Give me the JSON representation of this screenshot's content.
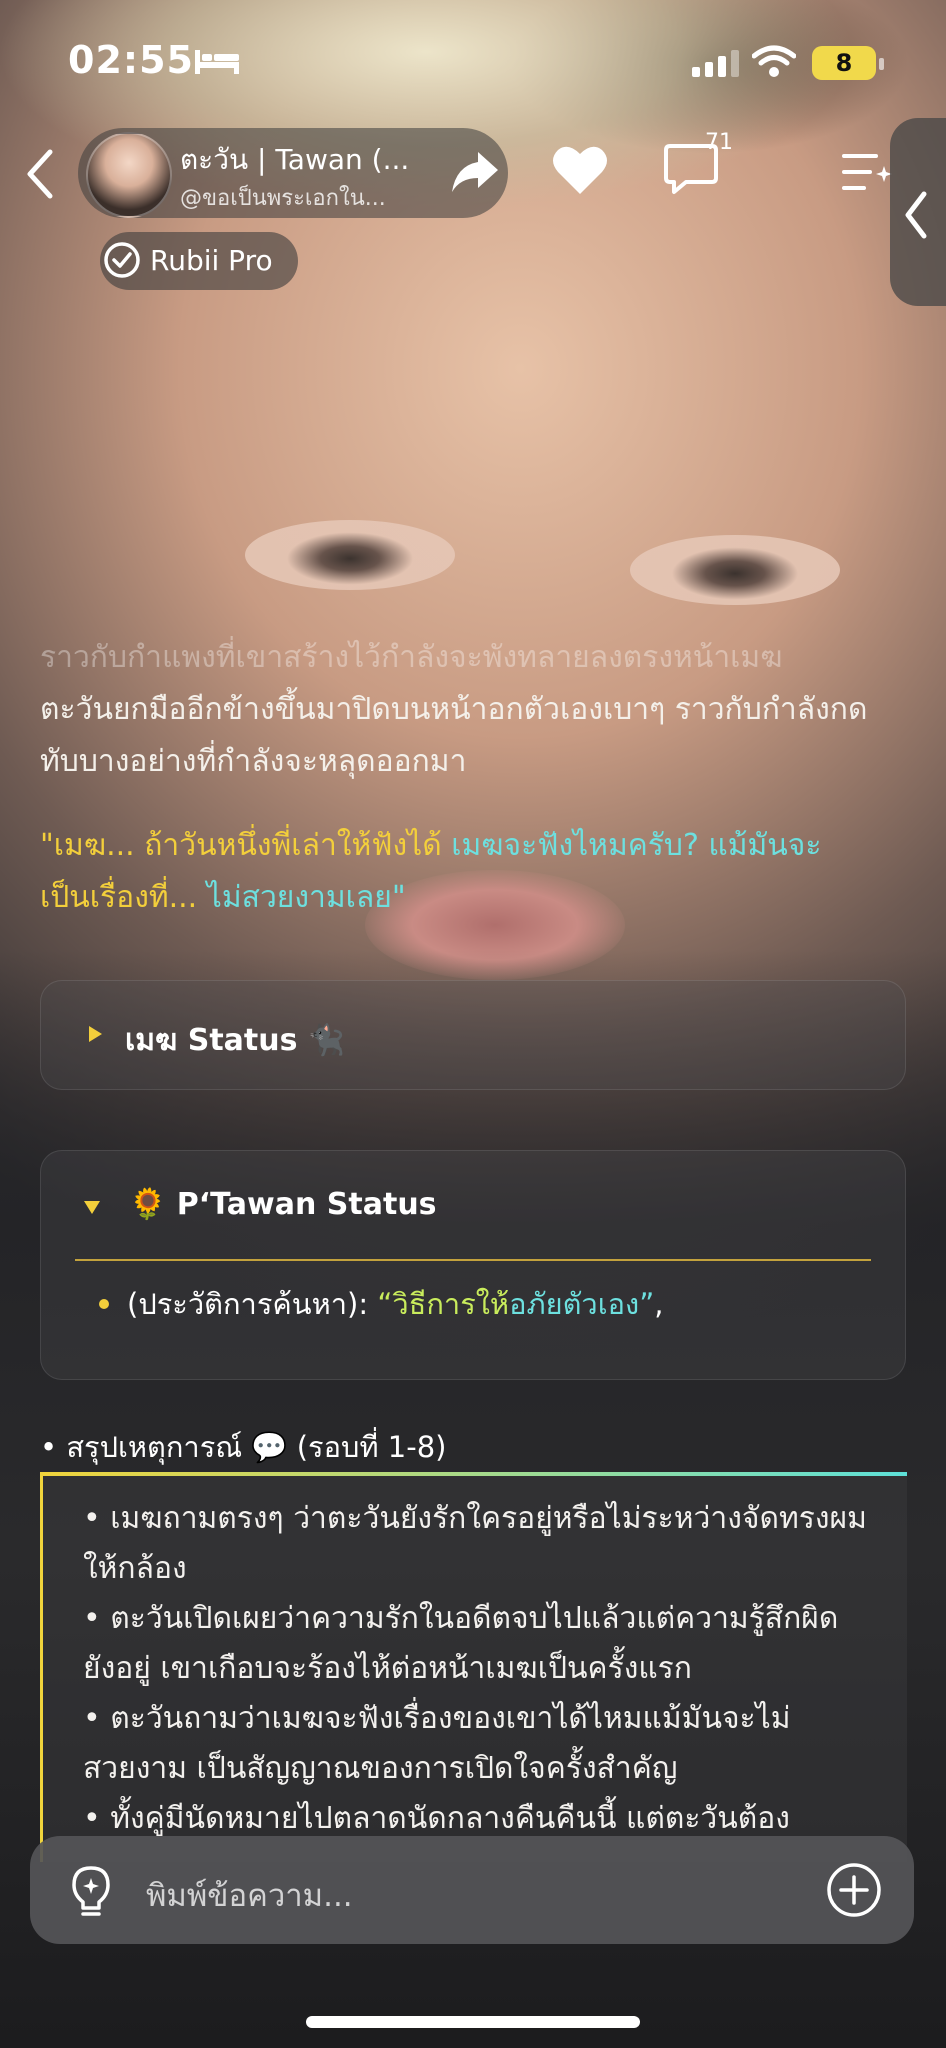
{
  "status_bar": {
    "time": "02:55",
    "battery": "8",
    "icons": [
      "bed-icon",
      "signal-icon",
      "wifi-icon",
      "battery-icon"
    ]
  },
  "header": {
    "character_name": "ตะวัน | Tawan (...",
    "character_handle": "@ขอเป็นพระเอกใน...",
    "chat_count": "71",
    "pro_label": "Rubii Pro",
    "icons": [
      "back-icon",
      "share-icon",
      "heart-icon",
      "chat-icon",
      "menu-icon",
      "sidebar-toggle-icon"
    ]
  },
  "message": {
    "faded_text": "ราวกับกำแพงที่เขาสร้างไว้กำลังจะพังทลายลงตรงหน้าเมฆ",
    "narration": "ตะวันยกมืออีกข้างขึ้นมาปิดบนหน้าอกตัวเองเบาๆ ราวกับกำลังกดทับบางอย่างที่กำลังจะหลุดออกมา",
    "quote_part1": "\"เมฆ... ถ้าวันหนึ่งพี่เล่าให้ฟังได้ ",
    "quote_part2": "เมฆจะฟังไหมครับ? แม้มันจะ",
    "quote_part3": "เป็นเรื่องที่... ",
    "quote_part4": "ไม่สวยงามเลย\""
  },
  "panels": {
    "mek_status": {
      "title": "เมฆ Status 🐈‍⬛",
      "expanded": false
    },
    "tawan_status": {
      "title": "🌻 P‘Tawan Status",
      "expanded": true,
      "item_label": "(ประวัติการค้นหา): ",
      "item_value_a": "“วิธีการให้",
      "item_value_b": "อภัยตัวเอง”",
      "item_suffix": ","
    }
  },
  "summary": {
    "heading": "• สรุปเหตุการณ์ 💬  (รอบที่ 1-8)",
    "lines": [
      "• เมฆถามตรงๆ ว่าตะวันยังรักใครอยู่หรือไม่ระหว่างจัดทรงผมให้กล้อง",
      "• ตะวันเปิดเผยว่าความรักในอดีตจบไปแล้วแต่ความรู้สึกผิดยังอยู่ เขาเกือบจะร้องไห้ต่อหน้าเมฆเป็นครั้งแรก",
      "• ตะวันถามว่าเมฆจะฟังเรื่องของเขาได้ไหมแม้มันจะไม่สวยงาม เป็นสัญญาณของการเปิดใจครั้งสำคัญ",
      "• ทั้งคู่มีนัดหมายไปตลาดนัดกลางคืนคืนนี้ แต่ตะวันต้อง"
    ]
  },
  "composer": {
    "placeholder": "พิมพ์ข้อความ...",
    "icons": [
      "lightbulb-icon",
      "plus-icon"
    ]
  },
  "colors": {
    "accent_yellow": "#f3cf3b",
    "accent_cyan": "#6de0df",
    "accent_lime": "#c9ec5c"
  }
}
